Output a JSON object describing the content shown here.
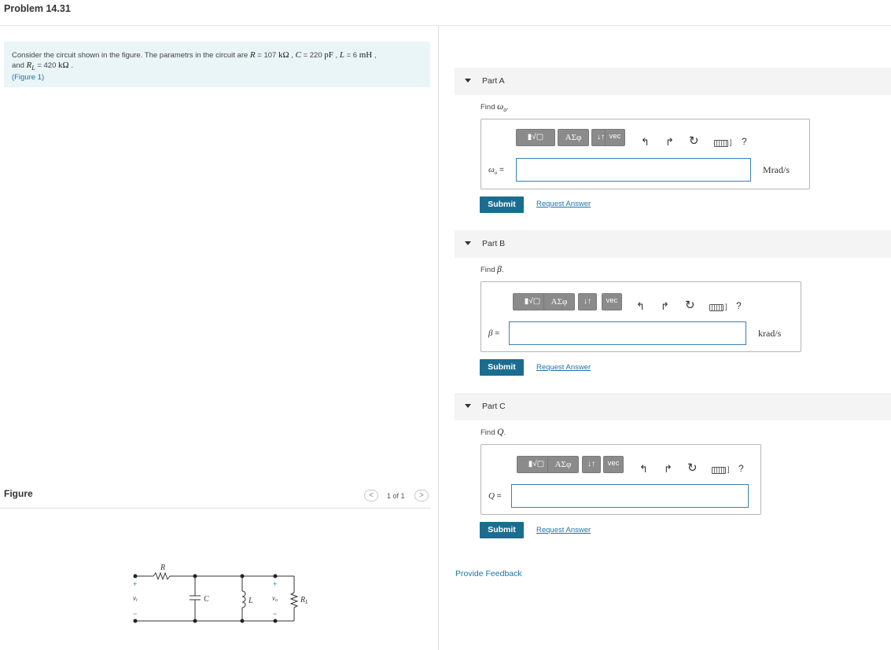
{
  "title": "Problem 14.31",
  "statement": {
    "line1_prefix": "Consider the circuit shown in the figure. The parametrs in the circuit are ",
    "R_math": "R",
    "eq1": " = 107 ",
    "R_unit": "kΩ",
    "sep1": " , ",
    "C_math": "C",
    "eq2": " = 220 ",
    "C_unit": "pF",
    "sep2": " , ",
    "L_math": "L",
    "eq3": " = 6 ",
    "L_unit": "mH",
    "sep3": " ,",
    "line2_prefix": "and ",
    "RL_math": "R",
    "RL_sub": "L",
    "eq4": " = 420 ",
    "RL_unit": "kΩ",
    "line2_end": " .",
    "figure_link": "(Figure 1)"
  },
  "figure": {
    "label": "Figure",
    "pager_prev": "<",
    "pager_next": ">",
    "pager_text": "1 of 1"
  },
  "circuit": {
    "R": "R",
    "C": "C",
    "L": "L",
    "RL": "R",
    "RL_sub": "L",
    "vi": "v",
    "vi_sub": "i",
    "vo": "v",
    "vo_sub": "o",
    "plus": "+",
    "minus": "−"
  },
  "toolbar": {
    "templates": "▮√▢",
    "greek": "ΑΣφ",
    "arrows": "↓↑",
    "vec": "vec",
    "undo": "↰",
    "redo": "↱",
    "reset": "↻",
    "kbd_caret": "]",
    "help": "?"
  },
  "parts": [
    {
      "name": "Part A",
      "find_prefix": "Find ",
      "find_var": "ω",
      "find_sub": "o",
      "find_suffix": ".",
      "var_label": "ω",
      "var_sub": "o",
      "equals": " =",
      "value": "",
      "unit": "Mrad/s",
      "submit": "Submit",
      "request": "Request Answer"
    },
    {
      "name": "Part B",
      "find_prefix": "Find ",
      "find_var": "β",
      "find_sub": "",
      "find_suffix": ".",
      "var_label": "β",
      "var_sub": "",
      "equals": " =",
      "value": "",
      "unit": "krad/s",
      "submit": "Submit",
      "request": "Request Answer"
    },
    {
      "name": "Part C",
      "find_prefix": "Find ",
      "find_var": "Q",
      "find_sub": "",
      "find_suffix": ".",
      "var_label": "Q",
      "var_sub": "",
      "equals": " =",
      "value": "",
      "unit": "",
      "submit": "Submit",
      "request": "Request Answer"
    }
  ],
  "feedback": "Provide Feedback"
}
